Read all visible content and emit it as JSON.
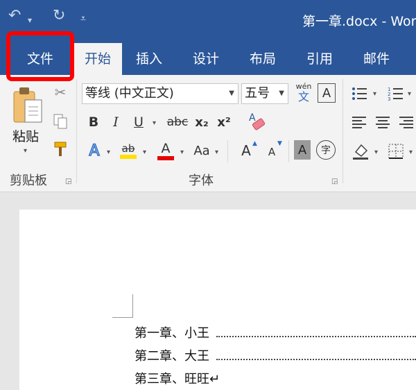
{
  "titlebar": {
    "document_title": "第一章.docx - Word",
    "undo_icon": "undo-icon",
    "redo_icon": "redo-icon",
    "customize_icon": "customize-qat-icon"
  },
  "tabs": [
    {
      "label": "文件"
    },
    {
      "label": "开始"
    },
    {
      "label": "插入"
    },
    {
      "label": "设计"
    },
    {
      "label": "布局"
    },
    {
      "label": "引用"
    },
    {
      "label": "邮件"
    }
  ],
  "clipboard": {
    "paste_label": "粘贴",
    "group_label": "剪贴板"
  },
  "font": {
    "font_name": "等线 (中文正文)",
    "font_size": "五号",
    "phonetic_top": "wén",
    "phonetic_bottom": "文",
    "char_border": "A",
    "bold": "B",
    "italic": "I",
    "underline": "U",
    "strike": "abc",
    "subscript": "x₂",
    "superscript": "x²",
    "text_effect": "A",
    "highlight": "ab",
    "font_color": "A",
    "change_case": "Aa",
    "grow": "A",
    "shrink": "A",
    "char_shading": "A",
    "enclose": "字",
    "group_label": "字体"
  },
  "document": {
    "toc": [
      {
        "text": "第一章、小王",
        "leader": true
      },
      {
        "text": "第二章、大王",
        "leader": true
      },
      {
        "text": "第三章、旺旺↵",
        "leader": false
      }
    ]
  },
  "colors": {
    "brand": "#2b579a",
    "highlight_box": "#ff0000",
    "highlight_yellow": "#ffe000",
    "font_red": "#e60000"
  }
}
